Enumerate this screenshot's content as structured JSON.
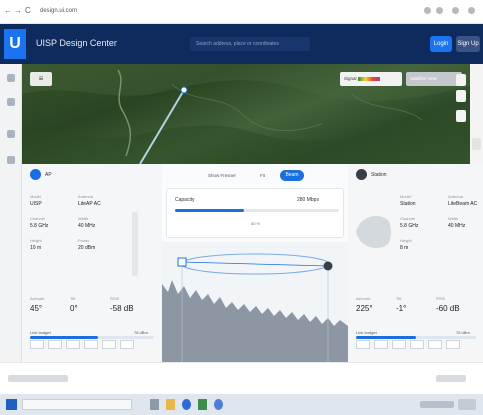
{
  "browser": {
    "nav_back": "←",
    "nav_forward": "→",
    "nav_reload": "C",
    "url": "design.ui.com"
  },
  "header": {
    "logo_letter": "U",
    "title": "UISP Design Center",
    "search_placeholder": "Search address, place or coordinates",
    "primary_button": "Login",
    "secondary_button": "Sign Up"
  },
  "map": {
    "menu_icon": "≡",
    "legend_label": "Signal",
    "mode_label": "Satellite View"
  },
  "center": {
    "control_a": "Show Fresnel",
    "control_b": "Fit",
    "pill_label": "Beam",
    "capacity_label": "Capacity",
    "capacity_value": "280 Mbps",
    "capacity_fraction": 0.42,
    "capacity_note": "80 %"
  },
  "left_device": {
    "name": "AP",
    "dot_color": "#1a6fe0",
    "fields": [
      {
        "label": "Model",
        "value": "UISP"
      },
      {
        "label": "Antenna",
        "value": "LiteAP AC"
      },
      {
        "label": "Channel",
        "value": "5.8 GHz"
      },
      {
        "label": "Width",
        "value": "40 MHz"
      },
      {
        "label": "Height",
        "value": "10 m"
      },
      {
        "label": "Power",
        "value": "20 dBm"
      }
    ],
    "stats": [
      {
        "label": "Azimuth",
        "value": "45°"
      },
      {
        "label": "Tilt",
        "value": "0°"
      },
      {
        "label": "RSSI",
        "value": "-58 dB"
      }
    ],
    "bar_label": "Link budget",
    "bar_value": "78 dBm",
    "bar_fraction": 0.55
  },
  "right_device": {
    "name": "Station",
    "dot_color": "#3a3f47",
    "fields": [
      {
        "label": "Model",
        "value": "Station"
      },
      {
        "label": "Antenna",
        "value": "LiteBeam AC"
      },
      {
        "label": "Channel",
        "value": "5.8 GHz"
      },
      {
        "label": "Width",
        "value": "40 MHz"
      },
      {
        "label": "Height",
        "value": "8 m"
      }
    ],
    "stats": [
      {
        "label": "Azimuth",
        "value": "225°"
      },
      {
        "label": "Tilt",
        "value": "-1°"
      },
      {
        "label": "RSSI",
        "value": "-60 dB"
      }
    ],
    "bar_label": "Link budget",
    "bar_value": "75 dBm",
    "bar_fraction": 0.5
  },
  "colors": {
    "brand": "#1a74f0",
    "header_bg": "#0f2a5c",
    "accent": "#1a6fe0"
  }
}
